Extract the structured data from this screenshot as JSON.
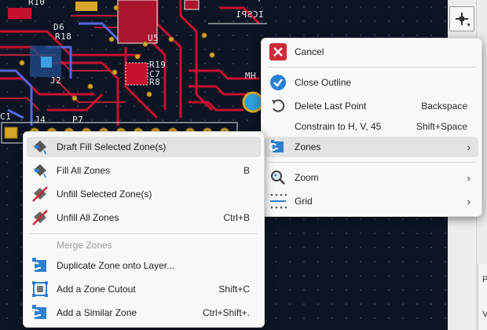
{
  "silkscreen": {
    "r10": "R10",
    "d6": "D6",
    "r18": "R18",
    "u5": "U5",
    "icsp": "ICSP1",
    "j2": "J2",
    "r19": "R19",
    "c7": "C7",
    "r8": "R8",
    "mh": "MH",
    "c1": "C1",
    "j4": "J4",
    "p7": "P7"
  },
  "context_menu": {
    "items": [
      {
        "label": "Draft Fill Selected Zone(s)",
        "shortcut": "",
        "icon": "zone-fill-icon",
        "highlighted": true
      },
      {
        "label": "Fill All Zones",
        "shortcut": "B",
        "icon": "zone-fill-icon"
      },
      {
        "label": "Unfill Selected Zone(s)",
        "shortcut": "",
        "icon": "zone-unfill-icon"
      },
      {
        "label": "Unfill All Zones",
        "shortcut": "Ctrl+B",
        "icon": "zone-unfill-icon"
      },
      {
        "label": "Merge Zones",
        "shortcut": "",
        "icon": "",
        "disabled": true
      },
      {
        "label": "Duplicate Zone onto Layer...",
        "shortcut": "",
        "icon": "zone-duplicate-icon"
      },
      {
        "label": "Add a Zone Cutout",
        "shortcut": "Shift+C",
        "icon": "zone-cutout-icon"
      },
      {
        "label": "Add a Similar Zone",
        "shortcut": "Ctrl+Shift+.",
        "icon": "zone-similar-icon"
      }
    ]
  },
  "parent_menu": {
    "items": [
      {
        "label": "Cancel",
        "shortcut": "",
        "icon": "cancel-icon"
      },
      {
        "label": "Close Outline",
        "shortcut": "",
        "icon": "checkmark-icon"
      },
      {
        "label": "Delete Last Point",
        "shortcut": "Backspace",
        "icon": "undo-icon"
      },
      {
        "label": "Constrain to H, V, 45",
        "shortcut": "Shift+Space",
        "icon": ""
      },
      {
        "label": "Zones",
        "shortcut": "",
        "icon": "zone-icon",
        "submenu": true,
        "highlighted": true
      },
      {
        "label": "Zoom",
        "shortcut": "",
        "icon": "zoom-icon",
        "submenu": true
      },
      {
        "label": "Grid",
        "shortcut": "",
        "icon": "grid-icon",
        "submenu": true
      }
    ]
  },
  "right_panel": {
    "chars": [
      "P",
      "V"
    ]
  },
  "colors": {
    "copper_top": "#c8102e",
    "copper_bottom": "#4b5fd8",
    "pad": "#d7a62a",
    "board_bg": "#0d1424",
    "menu_bg": "#f9f9f9",
    "highlight": "#e3e3e3"
  }
}
